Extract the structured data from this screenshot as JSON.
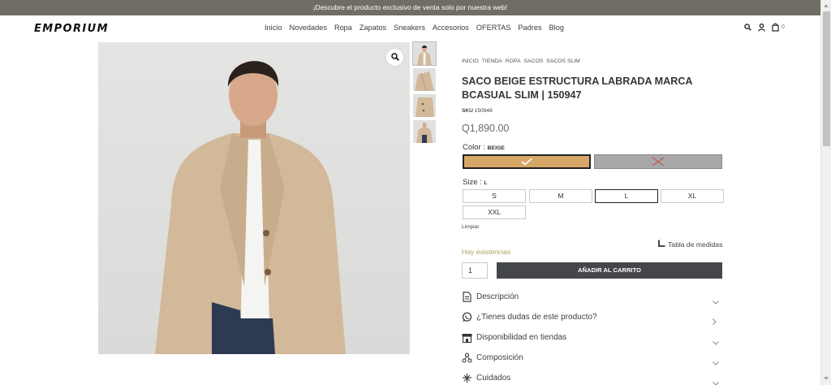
{
  "announcement": "¡Descubre el producto exclusivo de venta solo por nuestra web!",
  "brand": "EMPORIUM",
  "nav": [
    "Inicio",
    "Novedades",
    "Ropa",
    "Zapatos",
    "Sneakers",
    "Accesorios",
    "OFERTAS",
    "Padres",
    "Blog"
  ],
  "header_icons": {
    "search": "search-icon",
    "account": "user-icon",
    "cart": "bag-icon",
    "cart_count": "0"
  },
  "breadcrumb": [
    "INICIO",
    "TIENDA",
    "ROPA",
    "SACOS",
    "SACOS SLIM"
  ],
  "product": {
    "title": "SACO BEIGE ESTRUCTURA LABRADA MARCA BCASUAL SLIM | 150947",
    "sku_label": "SKU",
    "sku": "150948",
    "price": "Q1,890.00",
    "color_label": "Color",
    "color_value": "BEIGE",
    "colors": [
      {
        "name": "beige",
        "hex": "#d6a767",
        "selected": true,
        "available": true
      },
      {
        "name": "gris",
        "hex": "#a8a8a8",
        "selected": false,
        "available": false
      }
    ],
    "size_label": "Size",
    "size_value": "L",
    "sizes": [
      "S",
      "M",
      "L",
      "XL",
      "XXL"
    ],
    "selected_size": "L",
    "clear_label": "Limpiar",
    "size_chart_label": "Tabla de medidas",
    "stock_text": "Hay existencias",
    "stock_color": "#a9a15f",
    "quantity": "1",
    "add_to_cart": "AÑADIR AL CARRITO"
  },
  "accordion": [
    {
      "label": "Descripción",
      "icon": "document-icon"
    },
    {
      "label": "¿Tienes dudas de este producto?",
      "icon": "whatsapp-icon"
    },
    {
      "label": "Disponibilidad en tiendas",
      "icon": "store-icon"
    },
    {
      "label": "Composición",
      "icon": "composition-icon"
    },
    {
      "label": "Cuidados",
      "icon": "care-icon"
    }
  ]
}
